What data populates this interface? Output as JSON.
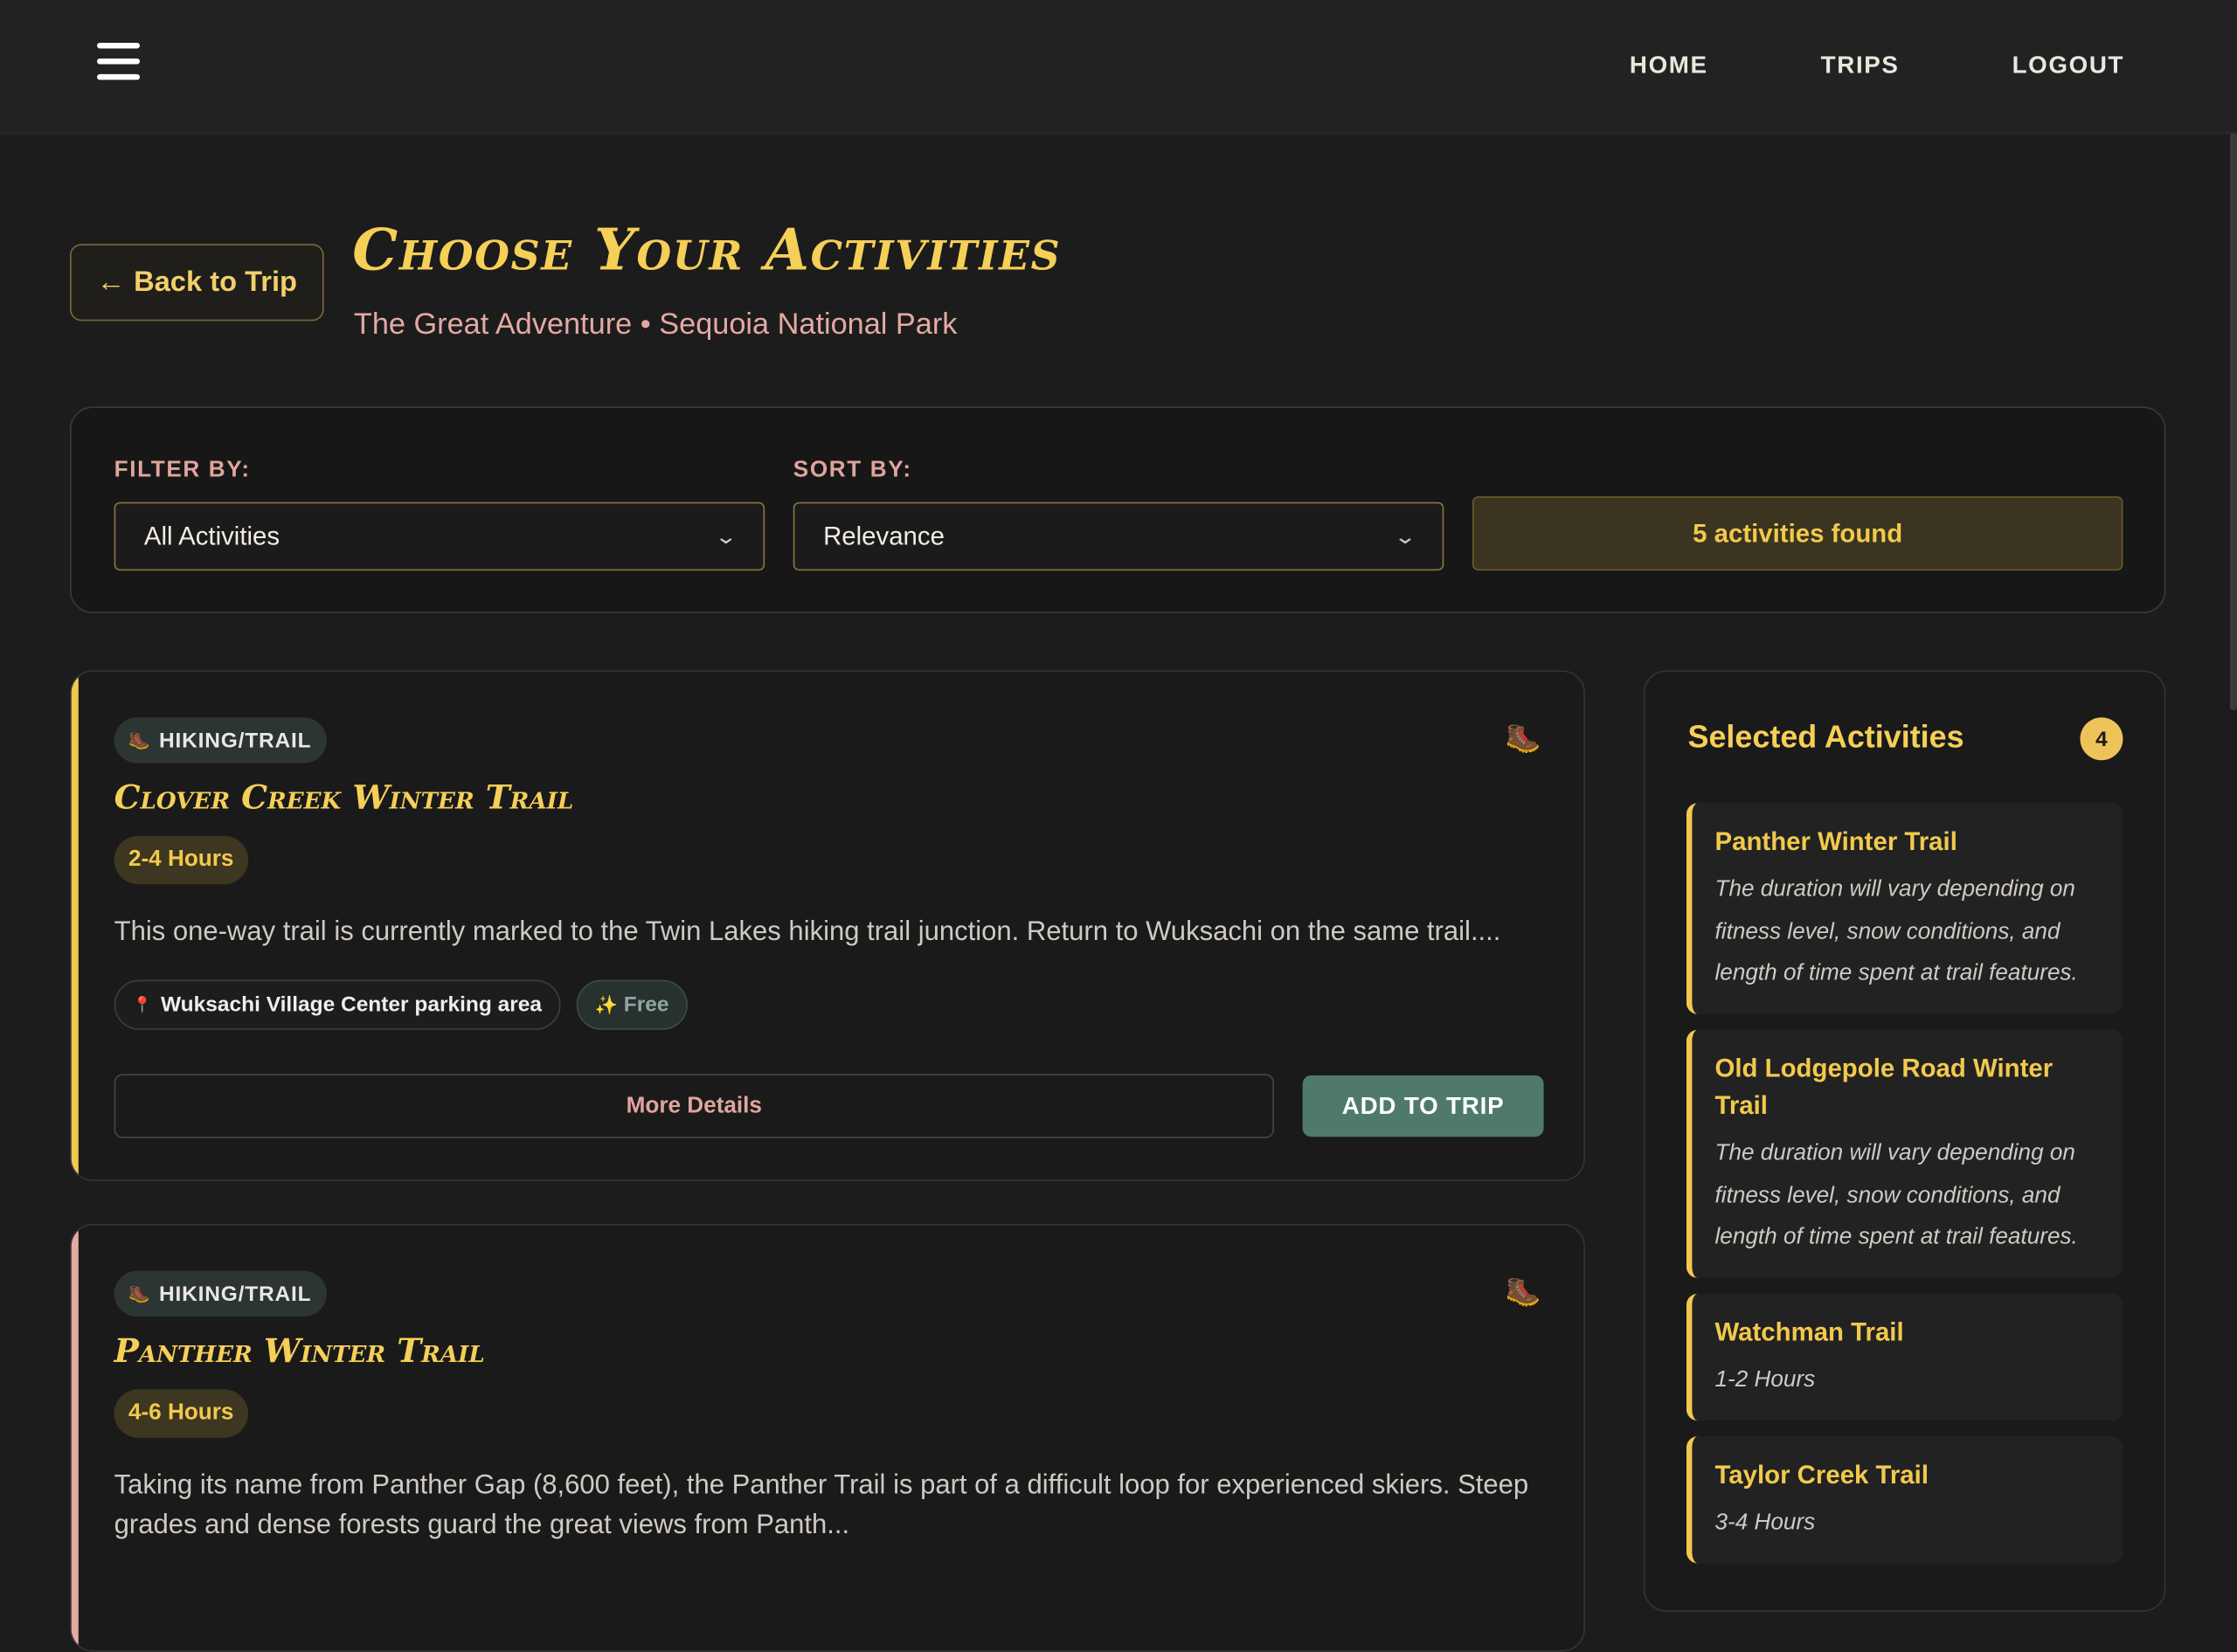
{
  "nav": {
    "items": [
      "HOME",
      "TRIPS",
      "LOGOUT"
    ]
  },
  "header": {
    "back_label": "Back to Trip",
    "back_arrow": "←",
    "title": "Choose Your Activities",
    "subtitle": "The Great Adventure • Sequoia National Park"
  },
  "filters": {
    "filter_label": "FILTER BY:",
    "filter_value": "All Activities",
    "sort_label": "SORT BY:",
    "sort_value": "Relevance",
    "found_text": "5 activities found"
  },
  "activities": [
    {
      "tag": "HIKING/TRAIL",
      "title": "Clover Creek Winter Trail",
      "duration": "2-4 Hours",
      "description": "This one-way trail is currently marked to the Twin Lakes hiking trail junction. Return to Wuksachi on the same trail....",
      "location": "Wuksachi Village Center parking area",
      "price": "Free",
      "more_label": "More Details",
      "add_label": "ADD TO TRIP",
      "accent": "#f2c94c"
    },
    {
      "tag": "HIKING/TRAIL",
      "title": "Panther Winter Trail",
      "duration": "4-6 Hours",
      "description": "Taking its name from Panther Gap (8,600 feet), the Panther Trail is part of a difficult loop for experienced skiers. Steep grades and dense forests guard the great views from Panth...",
      "accent": "#e4a9a1"
    }
  ],
  "selected": {
    "title": "Selected Activities",
    "count": "4",
    "items": [
      {
        "name": "Panther Winter Trail",
        "desc": "The duration will vary depending on fitness level, snow conditions, and length of time spent at trail features."
      },
      {
        "name": "Old Lodgepole Road Winter Trail",
        "desc": "The duration will vary depending on fitness level, snow conditions, and length of time spent at trail features."
      },
      {
        "name": "Watchman Trail",
        "desc": "1-2 Hours"
      },
      {
        "name": "Taylor Creek Trail",
        "desc": "3-4 Hours"
      }
    ]
  },
  "icons": {
    "menu": "hamburger-icon",
    "tag": "boot-icon",
    "location": "pin-icon",
    "free": "sparkles-icon"
  },
  "colors": {
    "background": "#1c1c1d",
    "accent_gold": "#f6cf57",
    "accent_pink": "#e4a9a1",
    "button_green": "#4f7a6b"
  }
}
